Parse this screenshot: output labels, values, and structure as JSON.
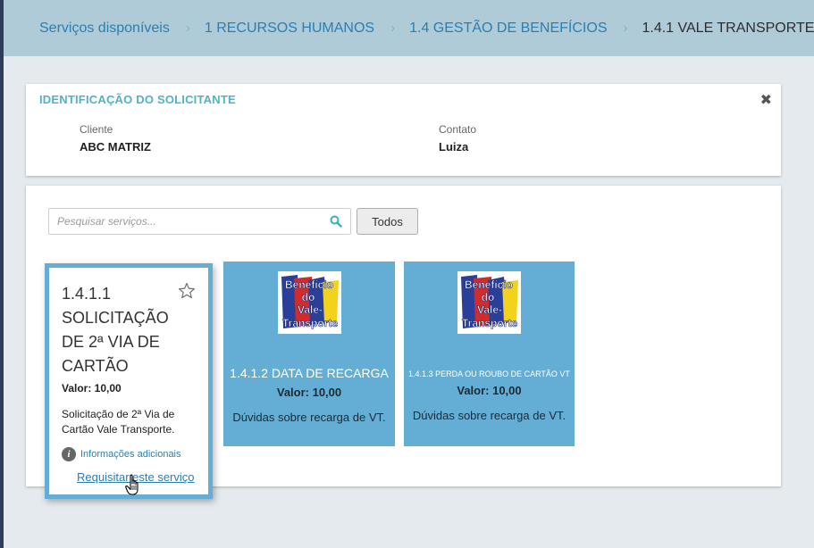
{
  "breadcrumb": {
    "items": [
      {
        "label": "Serviços disponíveis"
      },
      {
        "label": "1 RECURSOS HUMANOS"
      },
      {
        "label": "1.4 GESTÃO DE BENEFÍCIOS"
      },
      {
        "label": "1.4.1 VALE TRANSPORTE"
      }
    ],
    "separator": "›"
  },
  "requester": {
    "title": "IDENTIFICAÇÃO DO SOLICITANTE",
    "close_icon": "close-icon",
    "client_label": "Cliente",
    "client_value": "ABC MATRIZ",
    "contact_label": "Contato",
    "contact_value": "Luiza"
  },
  "services": {
    "search_placeholder": "Pesquisar serviços...",
    "filter_button": "Todos",
    "active_card": {
      "title": "1.4.1.1 SOLICITAÇÃO DE 2ª VIA DE CARTÃO",
      "price": "Valor: 10,00",
      "description": "Solicitação de 2ª Via de Cartão Vale Transporte.",
      "info_link": "Informações adicionais",
      "request_link": "Requisitar este serviço"
    },
    "cards": [
      {
        "title": "1.4.1.2 DATA DE RECARGA",
        "price": "Valor: 10,00",
        "description": "Dúvidas sobre recarga de VT.",
        "logo_text": [
          "Benefício",
          "do",
          "Vale-",
          "Transporte"
        ]
      },
      {
        "title": "1.4.1.3 PERDA OU ROUBO DE CARTÃO VT",
        "price": "Valor: 10,00",
        "description": "Dúvidas sobre recarga de VT.",
        "logo_text": [
          "Benefício",
          "do",
          "Vale-",
          "Transporte"
        ]
      }
    ]
  },
  "colors": {
    "accent": "#4fb3c4",
    "card_blue": "#64aed5",
    "link": "#2b7fb0",
    "breadcrumb_bg": "#b0cbd8"
  }
}
